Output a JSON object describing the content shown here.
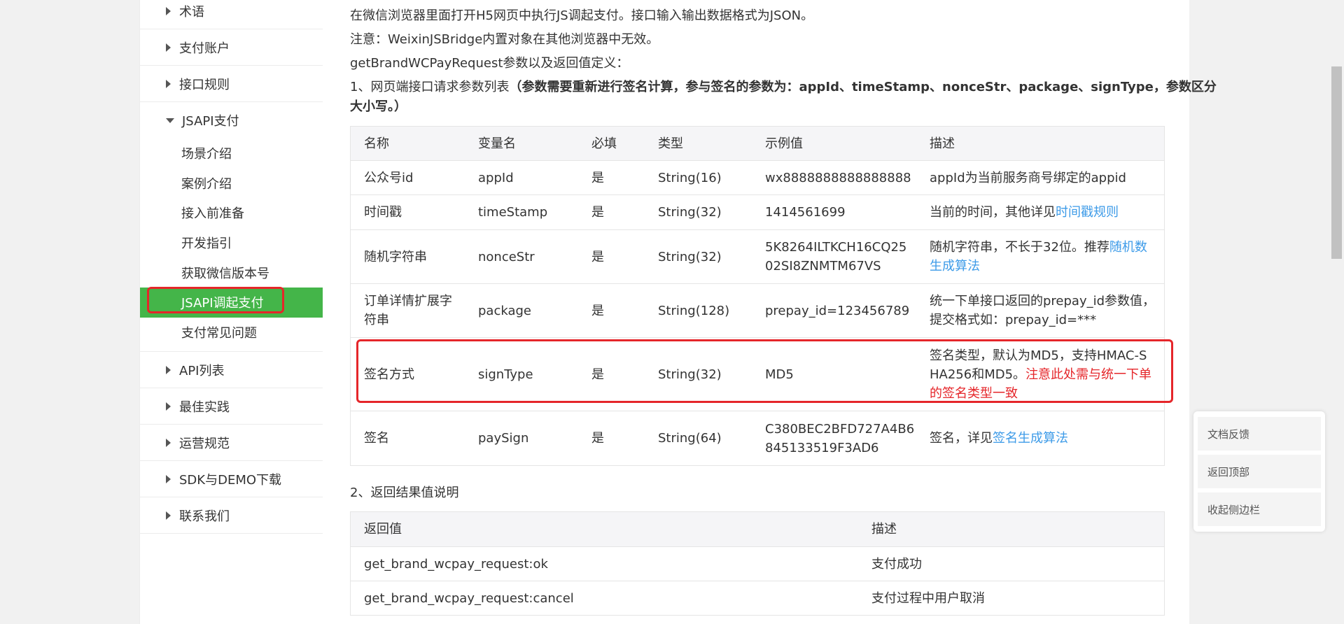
{
  "sidebar": {
    "items_top": [
      {
        "label": "术语"
      },
      {
        "label": "支付账户"
      },
      {
        "label": "接口规则"
      }
    ],
    "open_section": {
      "label": "JSAPI支付",
      "children": [
        "场景介绍",
        "案例介绍",
        "接入前准备",
        "开发指引",
        "获取微信版本号",
        "JSAPI调起支付",
        "支付常见问题"
      ],
      "active_index": 5
    },
    "items_bottom": [
      {
        "label": "API列表"
      },
      {
        "label": "最佳实践"
      },
      {
        "label": "运营规范"
      },
      {
        "label": "SDK与DEMO下载"
      },
      {
        "label": "联系我们"
      }
    ]
  },
  "main": {
    "intro_line1": "在微信浏览器里面打开H5网页中执行JS调起支付。接口输入输出数据格式为JSON。",
    "intro_line2": "注意：WeixinJSBridge内置对象在其他浏览器中无效。",
    "intro_line3": "getBrandWCPayRequest参数以及返回值定义：",
    "section1_prefix": "1、网页端接口请求参数列表",
    "section1_bold_a": "（参数需要重新进行签名计算，参与签名的参数为：appId、timeStamp、nonceStr、package、signType，参数区分",
    "section1_bold_b": "大小写。）",
    "params_table": {
      "headers": [
        "名称",
        "变量名",
        "必填",
        "类型",
        "示例值",
        "描述"
      ],
      "rows": [
        {
          "name": "公众号id",
          "var": "appId",
          "req": "是",
          "type": "String(16)",
          "example": "wx8888888888888888",
          "desc": "appId为当前服务商号绑定的appid",
          "desc_link": ""
        },
        {
          "name": "时间戳",
          "var": "timeStamp",
          "req": "是",
          "type": "String(32)",
          "example": "1414561699",
          "desc": "当前的时间，其他详见",
          "desc_link": "时间戳规则"
        },
        {
          "name": "随机字符串",
          "var": "nonceStr",
          "req": "是",
          "type": "String(32)",
          "example_a": "5K8264ILTKCH16CQ25",
          "example_b": "02SI8ZNMTM67VS",
          "desc": "随机字符串，不长于32位。推荐",
          "desc_link_a": "随机数",
          "desc_link_b": "生成算法"
        },
        {
          "name_a": "订单详情扩展字",
          "name_b": "符串",
          "var": "package",
          "req": "是",
          "type": "String(128)",
          "example": "prepay_id=123456789",
          "desc_a": "统一下单接口返回的prepay_id参数值，",
          "desc_b": "提交格式如：prepay_id=***"
        },
        {
          "name": "签名方式",
          "var": "signType",
          "req": "是",
          "type": "String(32)",
          "example": "MD5",
          "desc_a": "签名类型，默认为MD5，支持HMAC-S",
          "desc_b": "HA256和MD5。",
          "desc_red_b": "注意此处需与统一下单",
          "desc_red_c": "的签名类型一致"
        },
        {
          "name": "签名",
          "var": "paySign",
          "req": "是",
          "type": "String(64)",
          "example_a": "C380BEC2BFD727A4B6",
          "example_b": "845133519F3AD6",
          "desc": "签名，详见",
          "desc_link": "签名生成算法"
        }
      ]
    },
    "section2": "2、返回结果值说明",
    "return_table": {
      "headers": [
        "返回值",
        "描述"
      ],
      "rows": [
        {
          "value": "get_brand_wcpay_request:ok",
          "desc": "支付成功"
        },
        {
          "value": "get_brand_wcpay_request:cancel",
          "desc": "支付过程中用户取消"
        }
      ]
    }
  },
  "float_panel": {
    "feedback": "文档反馈",
    "back_top": "返回顶部",
    "collapse": "收起侧边栏"
  },
  "colors": {
    "active_green": "#44b549",
    "highlight_red": "#e5262a",
    "link_blue": "#3d9be8"
  }
}
